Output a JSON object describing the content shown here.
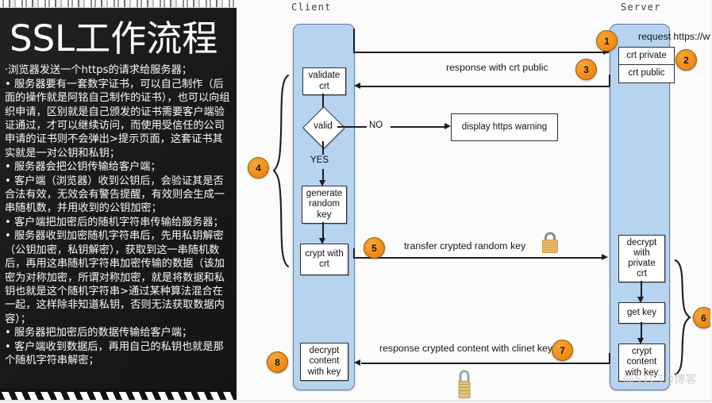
{
  "slide": {
    "title": "SSL工作流程",
    "bullets": [
      "·浏览器发送一个https的请求给服务器；",
      "• 服务器要有一套数字证书，可以自己制作（后面的操作就是阿铭自己制作的证书），也可以向组织申请，区别就是自己颁发的证书需要客户端验证通过，才可以继续访问，而使用受信任的公司申请的证书则不会弹出>提示页面，这套证书其实就是一对公钥和私钥；",
      "• 服务器会把公钥传输给客户端；",
      "• 客户端（浏览器）收到公钥后，会验证其是否合法有效，无效会有警告提醒，有效则会生成一串随机数，并用收到的公钥加密；",
      "• 客户端把加密后的随机字符串传输给服务器；",
      "• 服务器收到加密随机字符串后，先用私钥解密（公钥加密，私钥解密），获取到这一串随机数后，再用这串随机字符串加密传输的数据（该加密为对称加密，所谓对称加密，就是将数据和私钥也就是这个随机字符串>通过某种算法混合在一起，这样除非知道私钥，否则无法获取数据内容）；",
      "• 服务器把加密后的数据传输给客户端；",
      "• 客户端收到数据后，再用自己的私钥也就是那个随机字符串解密；"
    ]
  },
  "diagram": {
    "lanes": [
      {
        "id": "client",
        "label": "Client"
      },
      {
        "id": "server",
        "label": "Server"
      }
    ],
    "client_nodes": [
      {
        "id": "validate-crt",
        "lines": [
          "validate",
          "crt"
        ]
      },
      {
        "id": "valid-decision",
        "lines": [
          "valid"
        ]
      },
      {
        "id": "generate-random-key",
        "lines": [
          "generate",
          "random",
          "key"
        ]
      },
      {
        "id": "crypt-with-crt",
        "lines": [
          "crypt with",
          "crt"
        ]
      },
      {
        "id": "decrypt-content-with-key",
        "lines": [
          "decrypt",
          "content",
          "with key"
        ]
      }
    ],
    "server_nodes": [
      {
        "id": "crt-private",
        "lines": [
          "crt private"
        ]
      },
      {
        "id": "crt-public",
        "lines": [
          "crt public"
        ]
      },
      {
        "id": "decrypt-with-private-crt",
        "lines": [
          "decrypt",
          "with",
          "private",
          "crt"
        ]
      },
      {
        "id": "get-key",
        "lines": [
          "get key"
        ]
      },
      {
        "id": "crypt-content-with-key",
        "lines": [
          "crypt",
          "content",
          "with key"
        ]
      }
    ],
    "external_nodes": [
      {
        "id": "display-https-warning",
        "lines": [
          "display https warning"
        ]
      }
    ],
    "edge_labels": {
      "no": "NO",
      "yes": "YES"
    },
    "messages": [
      {
        "id": "msg-1",
        "text": "request https://www.domain.com/"
      },
      {
        "id": "msg-3",
        "text": "response with crt public"
      },
      {
        "id": "msg-5",
        "text": "transfer crypted random key"
      },
      {
        "id": "msg-7",
        "text": "response crypted content with clinet key"
      }
    ],
    "step_markers": [
      "1",
      "2",
      "3",
      "4",
      "5",
      "6",
      "7",
      "8"
    ],
    "watermark": "@51CTO博客",
    "colors": {
      "lane_fill": "#b6d3f0",
      "lane_stroke": "#5b7fb0",
      "marker_fill": "#ef8c17",
      "node_stroke": "#2e2e2e",
      "lock_body": "#e8b96a"
    }
  }
}
